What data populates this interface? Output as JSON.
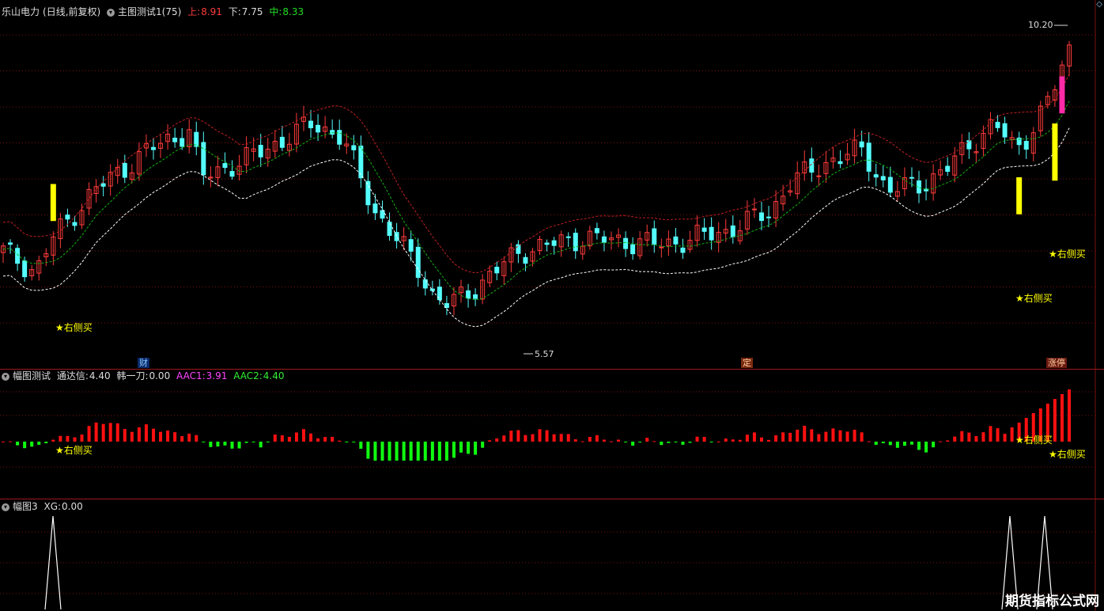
{
  "main_panel": {
    "stock_name": "乐山电力",
    "period": "(日线,前复权)",
    "indicator_name": "主图测试1(75)",
    "upper_label": "上:",
    "upper_value": "8.91",
    "lower_label": "下:",
    "lower_value": "7.75",
    "mid_label": "中:",
    "mid_value": "8.33",
    "high_marker": "10.20",
    "low_marker": "5.57",
    "tag_cai": "财",
    "tag_ding": "定",
    "tag_zhangting": "涨停"
  },
  "sub_panel_1": {
    "name": "幅图测试",
    "tongdaxin_label": "通达信:",
    "tongdaxin_value": "4.40",
    "hanyidao_label": "韩一刀:",
    "hanyidao_value": "0.00",
    "aac1_label": "AAC1:",
    "aac1_value": "3.91",
    "aac2_label": "AAC2:",
    "aac2_value": "4.40"
  },
  "sub_panel_2": {
    "name": "幅图3",
    "xg_label": "XG:",
    "xg_value": "0.00"
  },
  "signal_label": "★右侧买",
  "watermark": "期货指标公式网",
  "colors": {
    "up": "#ff3b3b",
    "down": "#54ffff",
    "upper_band": "#c02020",
    "mid_band": "#10b010",
    "lower_band": "#ffffff",
    "signal_bar": "#ffff00",
    "limit_up": "#ff2aa8",
    "macd_pos": "#ff1010",
    "macd_neg": "#10ff10",
    "aac1": "#ff44ff",
    "aac2": "#44ff44",
    "grid": "#7a1010"
  },
  "chart_data": [
    {
      "type": "candlestick",
      "title": "乐山电力 (日线,前复权)",
      "price_markers": {
        "high": 10.2,
        "low": 5.57
      },
      "bands": {
        "upper": 8.91,
        "lower": 7.75,
        "mid": 8.33
      },
      "signals": [
        "右侧买",
        "右侧买",
        "右侧买"
      ]
    },
    {
      "type": "bar",
      "title": "幅图测试",
      "series": [
        {
          "name": "通达信",
          "last": 4.4
        },
        {
          "name": "韩一刀",
          "last": 0.0
        },
        {
          "name": "AAC1",
          "last": 3.91
        },
        {
          "name": "AAC2",
          "last": 4.4
        }
      ]
    },
    {
      "type": "line",
      "title": "幅图3",
      "series": [
        {
          "name": "XG",
          "last": 0.0
        }
      ]
    }
  ]
}
